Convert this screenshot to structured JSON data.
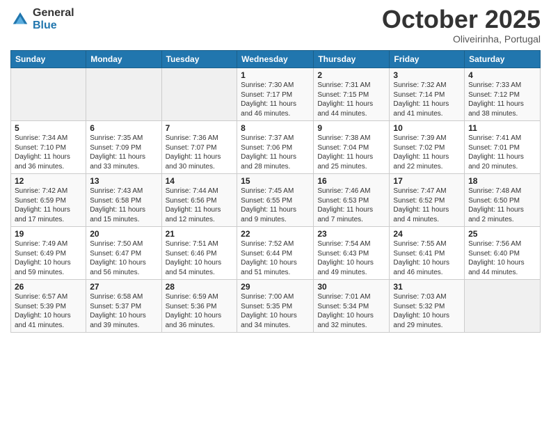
{
  "header": {
    "logo_general": "General",
    "logo_blue": "Blue",
    "month": "October 2025",
    "location": "Oliveirinha, Portugal"
  },
  "weekdays": [
    "Sunday",
    "Monday",
    "Tuesday",
    "Wednesday",
    "Thursday",
    "Friday",
    "Saturday"
  ],
  "weeks": [
    [
      {
        "day": "",
        "sunrise": "",
        "sunset": "",
        "daylight": ""
      },
      {
        "day": "",
        "sunrise": "",
        "sunset": "",
        "daylight": ""
      },
      {
        "day": "",
        "sunrise": "",
        "sunset": "",
        "daylight": ""
      },
      {
        "day": "1",
        "sunrise": "Sunrise: 7:30 AM",
        "sunset": "Sunset: 7:17 PM",
        "daylight": "Daylight: 11 hours and 46 minutes."
      },
      {
        "day": "2",
        "sunrise": "Sunrise: 7:31 AM",
        "sunset": "Sunset: 7:15 PM",
        "daylight": "Daylight: 11 hours and 44 minutes."
      },
      {
        "day": "3",
        "sunrise": "Sunrise: 7:32 AM",
        "sunset": "Sunset: 7:14 PM",
        "daylight": "Daylight: 11 hours and 41 minutes."
      },
      {
        "day": "4",
        "sunrise": "Sunrise: 7:33 AM",
        "sunset": "Sunset: 7:12 PM",
        "daylight": "Daylight: 11 hours and 38 minutes."
      }
    ],
    [
      {
        "day": "5",
        "sunrise": "Sunrise: 7:34 AM",
        "sunset": "Sunset: 7:10 PM",
        "daylight": "Daylight: 11 hours and 36 minutes."
      },
      {
        "day": "6",
        "sunrise": "Sunrise: 7:35 AM",
        "sunset": "Sunset: 7:09 PM",
        "daylight": "Daylight: 11 hours and 33 minutes."
      },
      {
        "day": "7",
        "sunrise": "Sunrise: 7:36 AM",
        "sunset": "Sunset: 7:07 PM",
        "daylight": "Daylight: 11 hours and 30 minutes."
      },
      {
        "day": "8",
        "sunrise": "Sunrise: 7:37 AM",
        "sunset": "Sunset: 7:06 PM",
        "daylight": "Daylight: 11 hours and 28 minutes."
      },
      {
        "day": "9",
        "sunrise": "Sunrise: 7:38 AM",
        "sunset": "Sunset: 7:04 PM",
        "daylight": "Daylight: 11 hours and 25 minutes."
      },
      {
        "day": "10",
        "sunrise": "Sunrise: 7:39 AM",
        "sunset": "Sunset: 7:02 PM",
        "daylight": "Daylight: 11 hours and 22 minutes."
      },
      {
        "day": "11",
        "sunrise": "Sunrise: 7:41 AM",
        "sunset": "Sunset: 7:01 PM",
        "daylight": "Daylight: 11 hours and 20 minutes."
      }
    ],
    [
      {
        "day": "12",
        "sunrise": "Sunrise: 7:42 AM",
        "sunset": "Sunset: 6:59 PM",
        "daylight": "Daylight: 11 hours and 17 minutes."
      },
      {
        "day": "13",
        "sunrise": "Sunrise: 7:43 AM",
        "sunset": "Sunset: 6:58 PM",
        "daylight": "Daylight: 11 hours and 15 minutes."
      },
      {
        "day": "14",
        "sunrise": "Sunrise: 7:44 AM",
        "sunset": "Sunset: 6:56 PM",
        "daylight": "Daylight: 11 hours and 12 minutes."
      },
      {
        "day": "15",
        "sunrise": "Sunrise: 7:45 AM",
        "sunset": "Sunset: 6:55 PM",
        "daylight": "Daylight: 11 hours and 9 minutes."
      },
      {
        "day": "16",
        "sunrise": "Sunrise: 7:46 AM",
        "sunset": "Sunset: 6:53 PM",
        "daylight": "Daylight: 11 hours and 7 minutes."
      },
      {
        "day": "17",
        "sunrise": "Sunrise: 7:47 AM",
        "sunset": "Sunset: 6:52 PM",
        "daylight": "Daylight: 11 hours and 4 minutes."
      },
      {
        "day": "18",
        "sunrise": "Sunrise: 7:48 AM",
        "sunset": "Sunset: 6:50 PM",
        "daylight": "Daylight: 11 hours and 2 minutes."
      }
    ],
    [
      {
        "day": "19",
        "sunrise": "Sunrise: 7:49 AM",
        "sunset": "Sunset: 6:49 PM",
        "daylight": "Daylight: 10 hours and 59 minutes."
      },
      {
        "day": "20",
        "sunrise": "Sunrise: 7:50 AM",
        "sunset": "Sunset: 6:47 PM",
        "daylight": "Daylight: 10 hours and 56 minutes."
      },
      {
        "day": "21",
        "sunrise": "Sunrise: 7:51 AM",
        "sunset": "Sunset: 6:46 PM",
        "daylight": "Daylight: 10 hours and 54 minutes."
      },
      {
        "day": "22",
        "sunrise": "Sunrise: 7:52 AM",
        "sunset": "Sunset: 6:44 PM",
        "daylight": "Daylight: 10 hours and 51 minutes."
      },
      {
        "day": "23",
        "sunrise": "Sunrise: 7:54 AM",
        "sunset": "Sunset: 6:43 PM",
        "daylight": "Daylight: 10 hours and 49 minutes."
      },
      {
        "day": "24",
        "sunrise": "Sunrise: 7:55 AM",
        "sunset": "Sunset: 6:41 PM",
        "daylight": "Daylight: 10 hours and 46 minutes."
      },
      {
        "day": "25",
        "sunrise": "Sunrise: 7:56 AM",
        "sunset": "Sunset: 6:40 PM",
        "daylight": "Daylight: 10 hours and 44 minutes."
      }
    ],
    [
      {
        "day": "26",
        "sunrise": "Sunrise: 6:57 AM",
        "sunset": "Sunset: 5:39 PM",
        "daylight": "Daylight: 10 hours and 41 minutes."
      },
      {
        "day": "27",
        "sunrise": "Sunrise: 6:58 AM",
        "sunset": "Sunset: 5:37 PM",
        "daylight": "Daylight: 10 hours and 39 minutes."
      },
      {
        "day": "28",
        "sunrise": "Sunrise: 6:59 AM",
        "sunset": "Sunset: 5:36 PM",
        "daylight": "Daylight: 10 hours and 36 minutes."
      },
      {
        "day": "29",
        "sunrise": "Sunrise: 7:00 AM",
        "sunset": "Sunset: 5:35 PM",
        "daylight": "Daylight: 10 hours and 34 minutes."
      },
      {
        "day": "30",
        "sunrise": "Sunrise: 7:01 AM",
        "sunset": "Sunset: 5:34 PM",
        "daylight": "Daylight: 10 hours and 32 minutes."
      },
      {
        "day": "31",
        "sunrise": "Sunrise: 7:03 AM",
        "sunset": "Sunset: 5:32 PM",
        "daylight": "Daylight: 10 hours and 29 minutes."
      },
      {
        "day": "",
        "sunrise": "",
        "sunset": "",
        "daylight": ""
      }
    ]
  ]
}
